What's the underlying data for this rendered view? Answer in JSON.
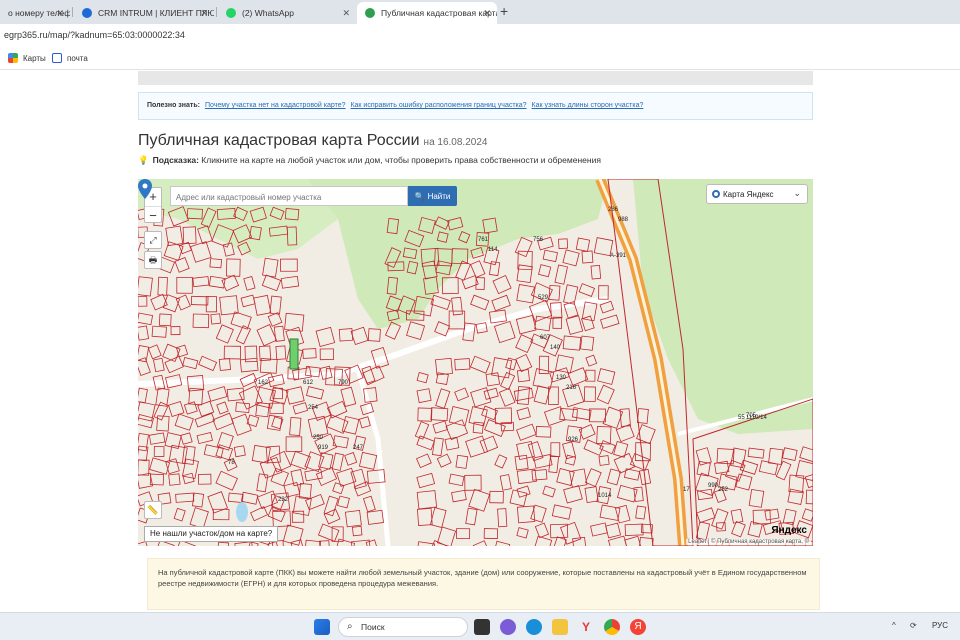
{
  "browser": {
    "tabs": [
      {
        "label": "о номеру телеф",
        "icon_color": "#d93025"
      },
      {
        "label": "CRM INTRUM | КЛИЕНТ ПЛЮС",
        "icon_color": "#1e6ad6"
      },
      {
        "label": "(2) WhatsApp",
        "icon_color": "#25d366"
      },
      {
        "label": "Публичная кадастровая карта",
        "icon_color": "#2e9f4c"
      }
    ],
    "new_tab": "+",
    "url": "egrp365.ru/map/?kadnum=65:03:0000022:34",
    "bookmarks": [
      {
        "label": "Карты",
        "icon": "maps-icon"
      },
      {
        "label": "почта",
        "icon": "mail-icon"
      }
    ]
  },
  "page": {
    "useful": {
      "prefix": "Полезно знать:",
      "links": [
        "Почему участка нет на кадастровой карте?",
        "Как исправить ошибку расположения границ участка?",
        "Как узнать длины сторон участка?"
      ]
    },
    "title": "Публичная кадастровая карта России",
    "title_date": "на 16.08.2024",
    "hint": {
      "label": "Подсказка:",
      "text": "Кликните на карте на любой участок или дом, чтобы проверить права собственности и обременения"
    },
    "map": {
      "zoom_in": "+",
      "zoom_out": "−",
      "search_placeholder": "Адрес или кадастровый номер участка",
      "search_button": "Найти",
      "layer": "Карта Яндекс",
      "not_found": "Не нашли участок/дом на карте?",
      "attribution": "Leaflet | © Публичная кадастровая карта, ©",
      "provider_logo": "Яндекс",
      "road_label": "А-391",
      "labels": [
        "286",
        "761",
        "756",
        "529",
        "607",
        "140",
        "130",
        "216",
        "55",
        "162",
        "612",
        "790",
        "254",
        "250",
        "919",
        "247",
        "1014",
        "252",
        "990",
        "705",
        "17",
        "1110/14",
        "78",
        "222",
        "926",
        "988",
        "114"
      ]
    },
    "info": "На публичной кадастровой карте (ПКК) вы можете найти любой земельный участок, здание (дом) или сооружение, которые поставлены на кадастровый учёт в Едином государственном реестре недвижимости (ЕГРН) и для которых проведена процедура межевания."
  },
  "taskbar": {
    "search_placeholder": "Поиск",
    "lang": "РУС"
  },
  "colors": {
    "map_bg": "#f1ede4",
    "forest": "#cfe9b8",
    "parcel_line": "#c1272d",
    "road": "#f0a040",
    "accent": "#2f6db3"
  }
}
